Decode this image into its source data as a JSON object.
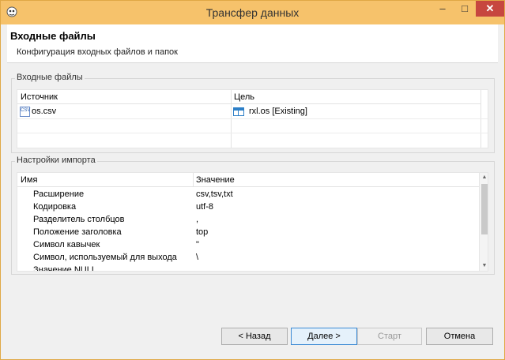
{
  "window": {
    "title": "Трансфер данных",
    "controls": {
      "minimize": "–",
      "maximize": "□",
      "close": "✕"
    }
  },
  "header": {
    "title": "Входные файлы",
    "description": "Конфигурация входных файлов и папок"
  },
  "input_files": {
    "group_label": "Входные файлы",
    "columns": {
      "source": "Источник",
      "target": "Цель"
    },
    "rows": [
      {
        "source": "os.csv",
        "source_icon_text": "CSV",
        "target": "rxl.os [Existing]"
      }
    ]
  },
  "import_settings": {
    "group_label": "Настройки импорта",
    "columns": {
      "name": "Имя",
      "value": "Значение"
    },
    "rows": [
      {
        "name": "Расширение",
        "value": "csv,tsv,txt"
      },
      {
        "name": "Кодировка",
        "value": "utf-8"
      },
      {
        "name": "Разделитель столбцов",
        "value": ","
      },
      {
        "name": "Положение заголовка",
        "value": "top"
      },
      {
        "name": "Символ кавычек",
        "value": "\""
      },
      {
        "name": "Символ, используемый для выхода",
        "value": "\\"
      },
      {
        "name": "Значение NULL",
        "value": ""
      }
    ]
  },
  "buttons": {
    "back": "< Назад",
    "next": "Далее >",
    "start": "Старт",
    "cancel": "Отмена"
  }
}
